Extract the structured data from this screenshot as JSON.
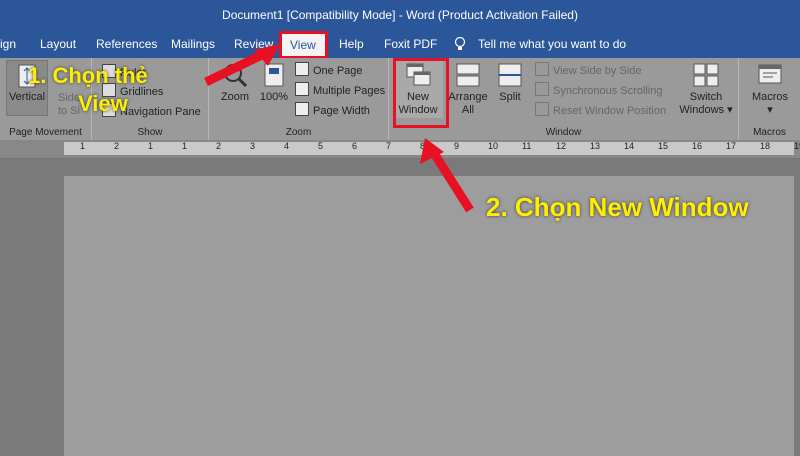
{
  "window": {
    "title": "Document1 [Compatibility Mode]  -  Word (Product Activation Failed)"
  },
  "tabs": [
    "ign",
    "Layout",
    "References",
    "Mailings",
    "Review",
    "View",
    "Help",
    "Foxit PDF"
  ],
  "tell_me": "Tell me what you want to do",
  "ribbon": {
    "page_movement": {
      "label": "Page Movement",
      "vertical": "Vertical",
      "side_line1": "Side",
      "side_line2": "to Si"
    },
    "show": {
      "label": "Show",
      "ruler": "Ruler",
      "gridlines": "Gridlines",
      "nav_pane": "Navigation Pane"
    },
    "zoom": {
      "label": "Zoom",
      "zoom": "Zoom",
      "percent": "100%",
      "one_page": "One Page",
      "multiple_pages": "Multiple Pages",
      "page_width": "Page Width"
    },
    "window": {
      "label": "Window",
      "new_window_line1": "New",
      "new_window_line2": "Window",
      "arrange_line1": "Arrange",
      "arrange_line2": "All",
      "split": "Split",
      "side_by_side": "View Side by Side",
      "sync_scroll": "Synchronous Scrolling",
      "reset_pos": "Reset Window Position",
      "switch_line1": "Switch",
      "switch_line2": "Windows ▾"
    },
    "macros": {
      "label": "Macros",
      "button": "Macros",
      "arrow": "▾"
    }
  },
  "ruler_numbers": [
    "1",
    "2",
    "1",
    "1",
    "2",
    "3",
    "4",
    "5",
    "6",
    "7",
    "8",
    "9",
    "10",
    "11",
    "12",
    "13",
    "14",
    "15",
    "16",
    "17",
    "18",
    "19"
  ],
  "annotations": {
    "step1_line1": "1. Chọn thẻ",
    "step1_line2": "View",
    "step2": "2. Chọn New Window"
  },
  "colors": {
    "title_blue": "#2b579a",
    "highlight_red": "#e81123",
    "annotation_yellow": "#ffee00"
  }
}
